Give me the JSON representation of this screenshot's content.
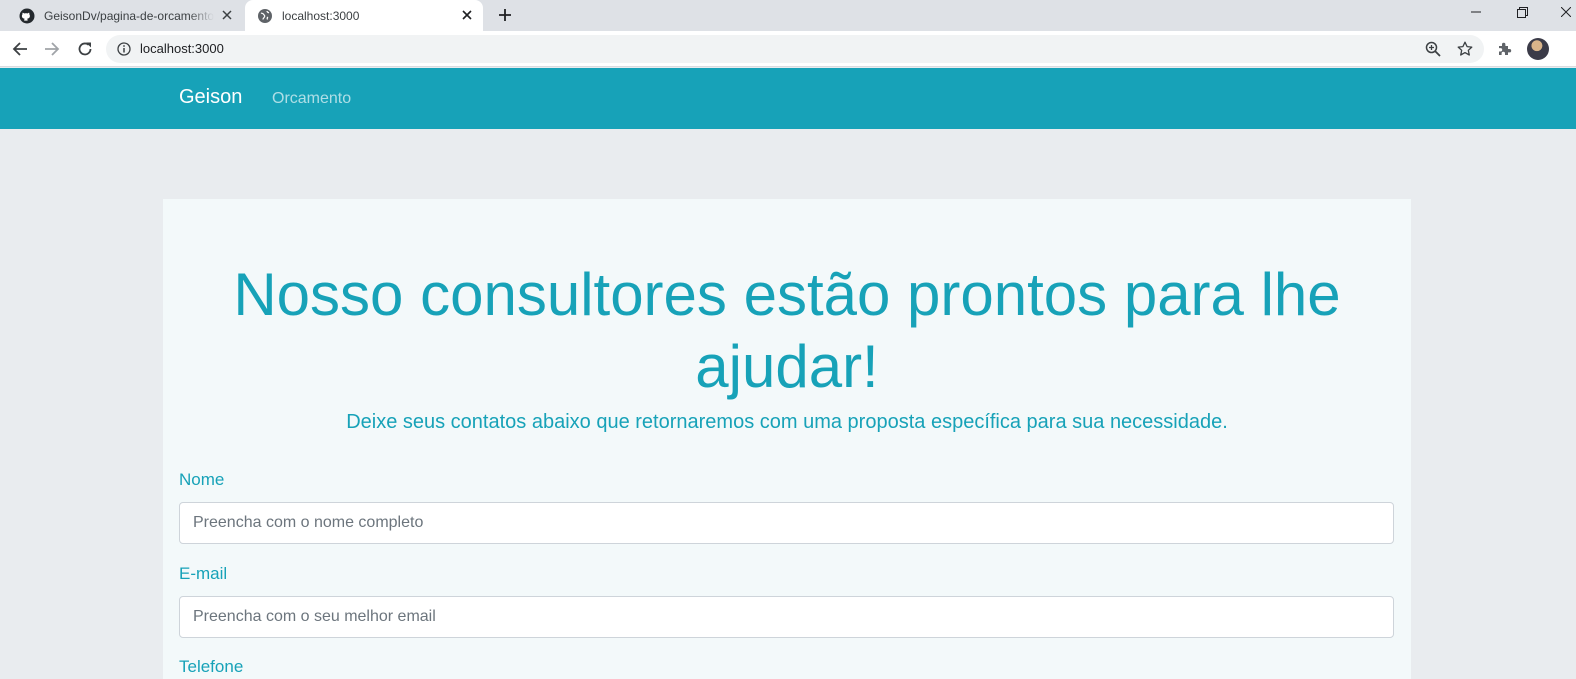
{
  "browser": {
    "tabs": [
      {
        "title": "GeisonDv/pagina-de-orcamento"
      },
      {
        "title": "localhost:3000"
      }
    ],
    "address": "localhost:3000",
    "icons": [
      "github-icon",
      "globe-icon",
      "close-icon",
      "plus-icon",
      "back-arrow-icon",
      "forward-arrow-icon",
      "reload-icon",
      "info-icon",
      "zoom-icon",
      "star-icon",
      "puzzle-icon",
      "avatar"
    ]
  },
  "navbar": {
    "brand": "Geison",
    "links": [
      "Orcamento"
    ],
    "color": "#17a2b8"
  },
  "hero": {
    "title_line1": "Nosso consultores estão prontos para lhe",
    "title_line2": "ajudar!",
    "lead": "Deixe seus contatos abaixo que retornaremos com uma proposta específica para sua necessidade."
  },
  "form": {
    "fields": [
      {
        "label": "Nome",
        "placeholder": "Preencha com o nome completo"
      },
      {
        "label": "E-mail",
        "placeholder": "Preencha com o seu melhor email"
      },
      {
        "label": "Telefone"
      }
    ]
  }
}
